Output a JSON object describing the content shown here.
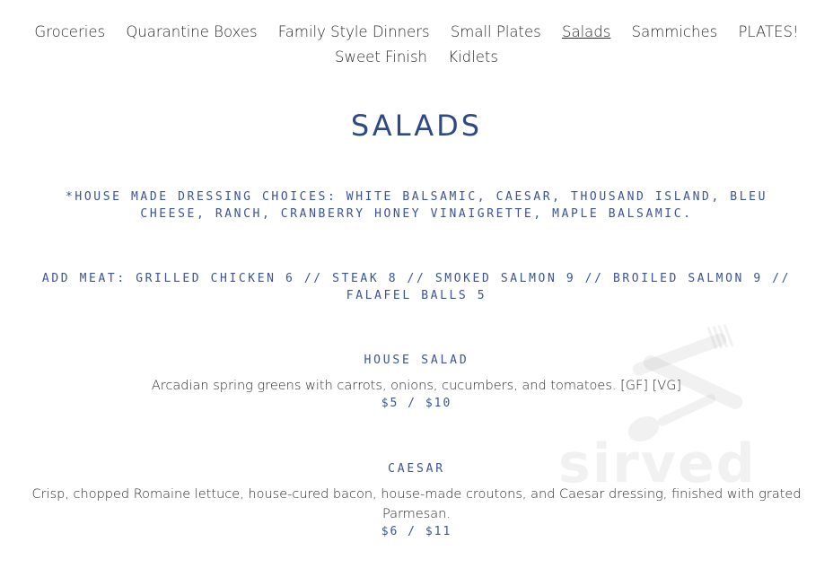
{
  "nav": {
    "row1": [
      "Groceries",
      "Quarantine Boxes",
      "Family Style Dinners",
      "Small Plates",
      "Salads",
      "Sammiches",
      "PLATES!"
    ],
    "row2": [
      "Sweet Finish",
      "Kidlets"
    ],
    "active": "Salads"
  },
  "section": {
    "title": "SALADS",
    "dressing_note": "*HOUSE MADE DRESSING CHOICES: WHITE BALSAMIC, CAESAR, THOUSAND ISLAND, BLEU CHEESE, RANCH, CRANBERRY HONEY VINAIGRETTE, MAPLE BALSAMIC.",
    "meat_note": "ADD MEAT: GRILLED CHICKEN 6 // STEAK 8 // SMOKED SALMON 9 // BROILED SALMON 9 // FALAFEL BALLS 5"
  },
  "items": [
    {
      "name": "HOUSE SALAD",
      "description": "Arcadian spring greens with carrots, onions, cucumbers, and tomatoes. [GF] [VG]",
      "price": "$5 / $10"
    },
    {
      "name": "CAESAR",
      "description": "Crisp, chopped Romaine lettuce, house-cured bacon, house-made croutons, and Caesar dressing, finished with grated Parmesan.",
      "price": "$6 / $11"
    }
  ],
  "watermark": {
    "text": "sirved",
    "icon": "fork-spoon-icon",
    "color": "#b4b4b4"
  },
  "colors": {
    "accent": "#2e4a86",
    "text": "#2b2b2b"
  }
}
